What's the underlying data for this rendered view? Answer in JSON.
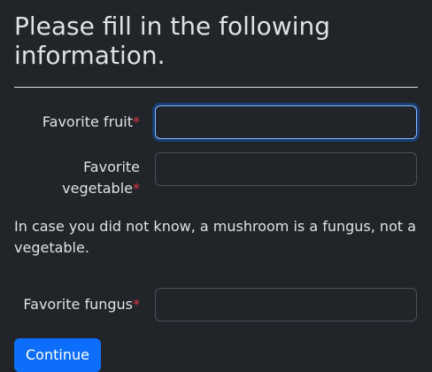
{
  "form": {
    "title": "Please fill in the following information.",
    "required_marker": "*",
    "fields": {
      "fruit": {
        "label": "Favorite fruit",
        "value": ""
      },
      "vegetable": {
        "label": "Favorite vegetable",
        "value": ""
      },
      "fungus": {
        "label": "Favorite fungus",
        "value": ""
      }
    },
    "note": "In case you did not know, a mushroom is a fungus, not a vegetable.",
    "submit_label": "Continue"
  },
  "colors": {
    "background": "#212529",
    "text": "#dee2e6",
    "required": "#dc3545",
    "primary": "#0d6efd",
    "focus_border": "#86b7fe"
  }
}
